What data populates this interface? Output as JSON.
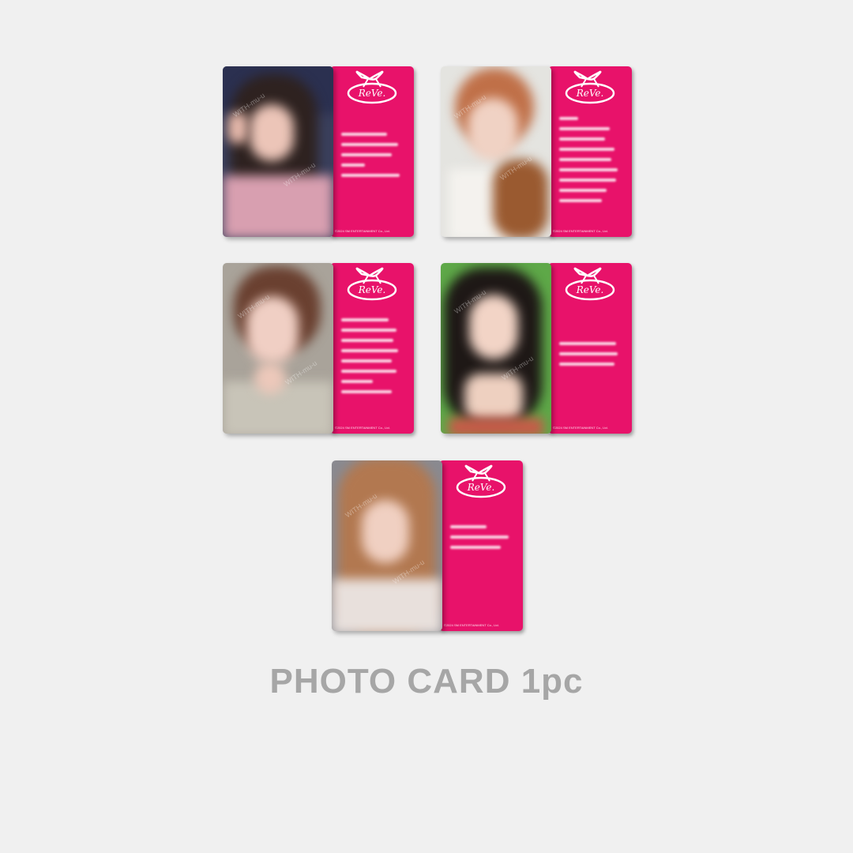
{
  "caption": "PHOTO CARD 1pc",
  "watermark": "WITH-mu-u",
  "card_back_color": "#e8126a",
  "cards": [
    {
      "photo": "blurred-selfie-peace-sign",
      "handwriting_lines": 5
    },
    {
      "photo": "blurred-selfie-with-teddy-bear",
      "handwriting_lines": 9
    },
    {
      "photo": "blurred-selfie-hand-on-chin",
      "handwriting_lines": 8
    },
    {
      "photo": "blurred-selfie-green-background",
      "handwriting_lines": 3
    },
    {
      "photo": "blurred-selfie-long-hair",
      "handwriting_lines": 3
    }
  ]
}
